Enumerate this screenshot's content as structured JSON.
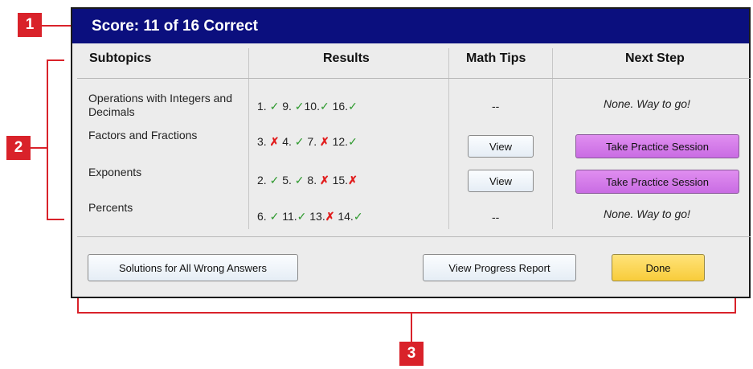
{
  "callouts": [
    "1",
    "2",
    "3"
  ],
  "dialog": {
    "title": "Score: 11 of 16 Correct",
    "headers": {
      "subtopics": "Subtopics",
      "results": "Results",
      "tips": "Math Tips",
      "next": "Next Step"
    },
    "rows": [
      {
        "topic": "Operations with Integers and Decimals",
        "results": [
          {
            "n": "1.",
            "mark": "✓"
          },
          {
            "n": "9.",
            "mark": "✓"
          },
          {
            "n": "10.",
            "mark": "✓"
          },
          {
            "n": "16.",
            "mark": "✓"
          }
        ],
        "tip": "--",
        "next": "None. Way to go!"
      },
      {
        "topic": "Factors and Fractions",
        "results": [
          {
            "n": "3.",
            "mark": "✗"
          },
          {
            "n": "4.",
            "mark": "✓"
          },
          {
            "n": "7.",
            "mark": "✗"
          },
          {
            "n": "12.",
            "mark": "✓"
          }
        ],
        "tip": "View",
        "next": "Take Practice Session"
      },
      {
        "topic": "Exponents",
        "results": [
          {
            "n": "2.",
            "mark": "✓"
          },
          {
            "n": "5.",
            "mark": "✓"
          },
          {
            "n": "8.",
            "mark": "✗"
          },
          {
            "n": "15.",
            "mark": "✗"
          }
        ],
        "tip": "View",
        "next": "Take Practice Session"
      },
      {
        "topic": "Percents",
        "results": [
          {
            "n": "6.",
            "mark": "✓"
          },
          {
            "n": "11.",
            "mark": "✓"
          },
          {
            "n": "13.",
            "mark": "✗"
          },
          {
            "n": "14.",
            "mark": "✓"
          }
        ],
        "tip": "--",
        "next": "None. Way to go!"
      }
    ],
    "footer": {
      "solutions_label": "Solutions for All Wrong Answers",
      "progress_label": "View Progress Report",
      "done_label": "Done"
    }
  },
  "colors": {
    "titlebar": "#0b0f7e",
    "callout": "#d9222a",
    "correct": "#2f9a2f",
    "wrong": "#e11d1d",
    "practice": "#d07ce8",
    "done": "#f9d24c"
  }
}
